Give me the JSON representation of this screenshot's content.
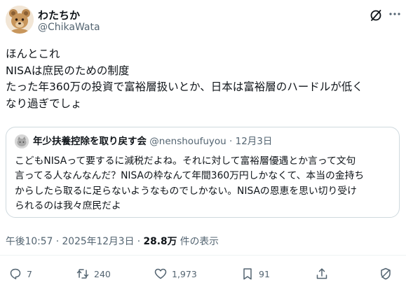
{
  "author": {
    "display_name": "わたちか",
    "handle": "@ChikaWata"
  },
  "tweet": {
    "lines": [
      "ほんとこれ",
      "NISAは庶民のための制度",
      "たった年360万の投資で富裕層扱いとか、日本は富裕層のハードルが低く",
      "なり過ぎでしょ"
    ]
  },
  "quote": {
    "name": "年少扶養控除を取り戻す会",
    "handle": "@nenshoufuyou",
    "separator": " · ",
    "date": "12月3日",
    "lines": [
      "こどもNISAって要するに減税だよね。それに対して富裕層優遇とか言って文句",
      "言ってる人なんなんだ？NISAの枠なんて年間360万円しかなくて、本当の金持ち",
      "からしたら取るに足らないようなものでしかない。NISAの恩恵を思い切り受け",
      "られるのは我々庶民だよ"
    ]
  },
  "meta": {
    "time": "午後10:57",
    "sep1": " · ",
    "date": "2025年12月3日",
    "sep2": " · ",
    "views": "28.8万",
    "views_suffix": " 件の表示"
  },
  "actions": {
    "replies": "7",
    "reposts": "240",
    "likes": "1,973",
    "bookmarks": "91"
  },
  "icons": {
    "grok": "grok-icon",
    "more": "more-icon",
    "reply": "reply-icon",
    "repost": "repost-icon",
    "like": "heart-icon",
    "bookmark": "bookmark-icon",
    "share": "share-icon",
    "block": "block-icon"
  }
}
